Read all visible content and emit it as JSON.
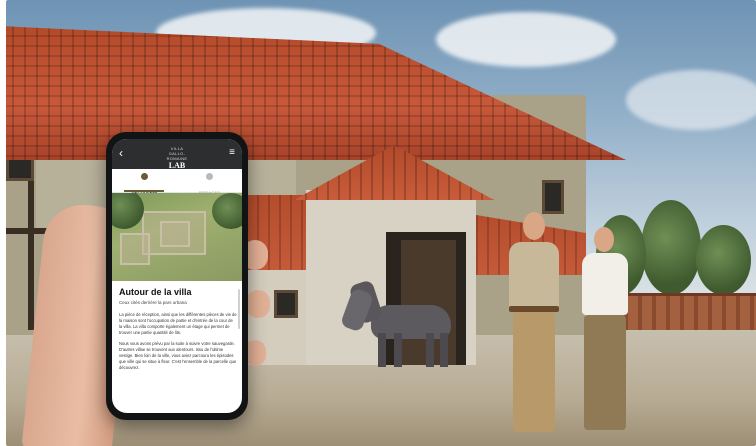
{
  "app": {
    "logo_top": "VILLA GALLO-ROMAINE",
    "logo_main": "LAB",
    "back_glyph": "‹",
    "menu_glyph": "≡"
  },
  "tabs": [
    {
      "label": "DÉCOUVRIR",
      "icon": "compass-icon",
      "active": true
    },
    {
      "label": "SERVICES",
      "icon": "info-icon",
      "active": false
    }
  ],
  "article": {
    "title": "Autour de la villa",
    "subtitle": "Ceux cités derrière la pars urbana",
    "paragraphs": [
      "La pièce de réception, ainsi que les différentes pièces de vie de la maison sont l'occupation de partie et d'entrée de la cour de la villa. La villa comporte également un étage qui permet de trouver une partie quantité de lits.",
      "Nous vous avons prévu par la suite à suivre votre sauvegarde. D'autres villae se trouvent aux alentours. Issu de l'ultime vestige. Bien loin de la ville, vous aviez parcouru les épisodes que ville qui se situe à fleur. C'est l'ensemble de la parcelle que découvrez."
    ]
  },
  "colors": {
    "app_bar": "#2c2e30",
    "accent": "#6b5a3a",
    "roof": "#c8593a"
  }
}
